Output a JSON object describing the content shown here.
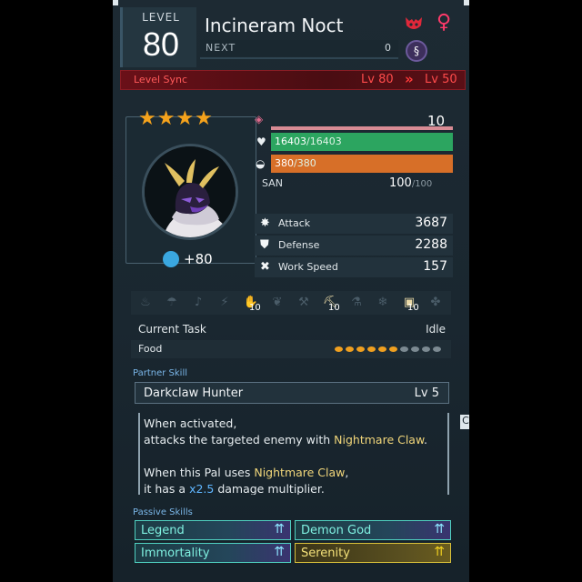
{
  "header": {
    "level_label": "LEVEL",
    "level": "80",
    "name": "Incineram Noct",
    "next_label": "NEXT",
    "next_value": "0",
    "gender_symbol": "♀"
  },
  "level_sync": {
    "label": "Level Sync",
    "from": "Lv 80",
    "arrow": "»",
    "to": "Lv 50"
  },
  "portrait": {
    "stars": "★★★★",
    "rank_bonus": "+80"
  },
  "stats": {
    "trust": "10",
    "hp_current": "16403",
    "hp_max": "/16403",
    "food_current": "380",
    "food_max": "/380",
    "san_label": "SAN",
    "san_current": "100",
    "san_max": "/100",
    "attack_label": "Attack",
    "attack_value": "3687",
    "defense_label": "Defense",
    "defense_value": "2288",
    "work_speed_label": "Work Speed",
    "work_speed_value": "157"
  },
  "work": {
    "suitability": [
      {
        "icon": "kindling-icon",
        "glyph": "♨",
        "lit": false,
        "level": ""
      },
      {
        "icon": "watering-icon",
        "glyph": "☂",
        "lit": false,
        "level": ""
      },
      {
        "icon": "planting-icon",
        "glyph": "♪",
        "lit": false,
        "level": ""
      },
      {
        "icon": "generating-icon",
        "glyph": "⚡",
        "lit": false,
        "level": ""
      },
      {
        "icon": "handiwork-icon",
        "glyph": "✋",
        "lit": true,
        "level": "10"
      },
      {
        "icon": "gathering-icon",
        "glyph": "❦",
        "lit": false,
        "level": ""
      },
      {
        "icon": "lumbering-icon",
        "glyph": "⚒",
        "lit": false,
        "level": ""
      },
      {
        "icon": "mining-icon",
        "glyph": "⛏",
        "lit": true,
        "level": "10"
      },
      {
        "icon": "medicine-icon",
        "glyph": "⚗",
        "lit": false,
        "level": ""
      },
      {
        "icon": "cooling-icon",
        "glyph": "❄",
        "lit": false,
        "level": ""
      },
      {
        "icon": "transporting-icon",
        "glyph": "▣",
        "lit": true,
        "level": "10"
      },
      {
        "icon": "farming-icon",
        "glyph": "✤",
        "lit": false,
        "level": ""
      }
    ],
    "current_task_label": "Current Task",
    "current_task_value": "Idle",
    "food_label": "Food",
    "food_filled": 6,
    "food_total": 10
  },
  "partner_skill": {
    "section_label": "Partner Skill",
    "name": "Darkclaw Hunter",
    "level": "Lv  5",
    "line1": "When activated,",
    "line2_pre": "attacks the targeted enemy with ",
    "line2_hl": "Nightmare Claw",
    "line2_post": ".",
    "line3_pre": "When this Pal uses ",
    "line3_hl": "Nightmare Claw",
    "line3_post": ",",
    "line4_pre": "it has a ",
    "line4_hl": "x2.5",
    "line4_post": " damage multiplier."
  },
  "side_tag": "C",
  "passives": {
    "section_label": "Passive Skills",
    "items": [
      {
        "label": "Legend",
        "tier": "rainbow"
      },
      {
        "label": "Demon God",
        "tier": "rainbow"
      },
      {
        "label": "Immortality",
        "tier": "rainbow"
      },
      {
        "label": "Serenity",
        "tier": "gold"
      }
    ]
  },
  "colors": {
    "hp": "#2ca560",
    "food": "#d76f28",
    "trust": "#d88b94",
    "level_sync": "#ff4b4b",
    "highlight": "#f1d67a",
    "multiplier": "#5fb6ff",
    "star": "#f4a21c"
  }
}
